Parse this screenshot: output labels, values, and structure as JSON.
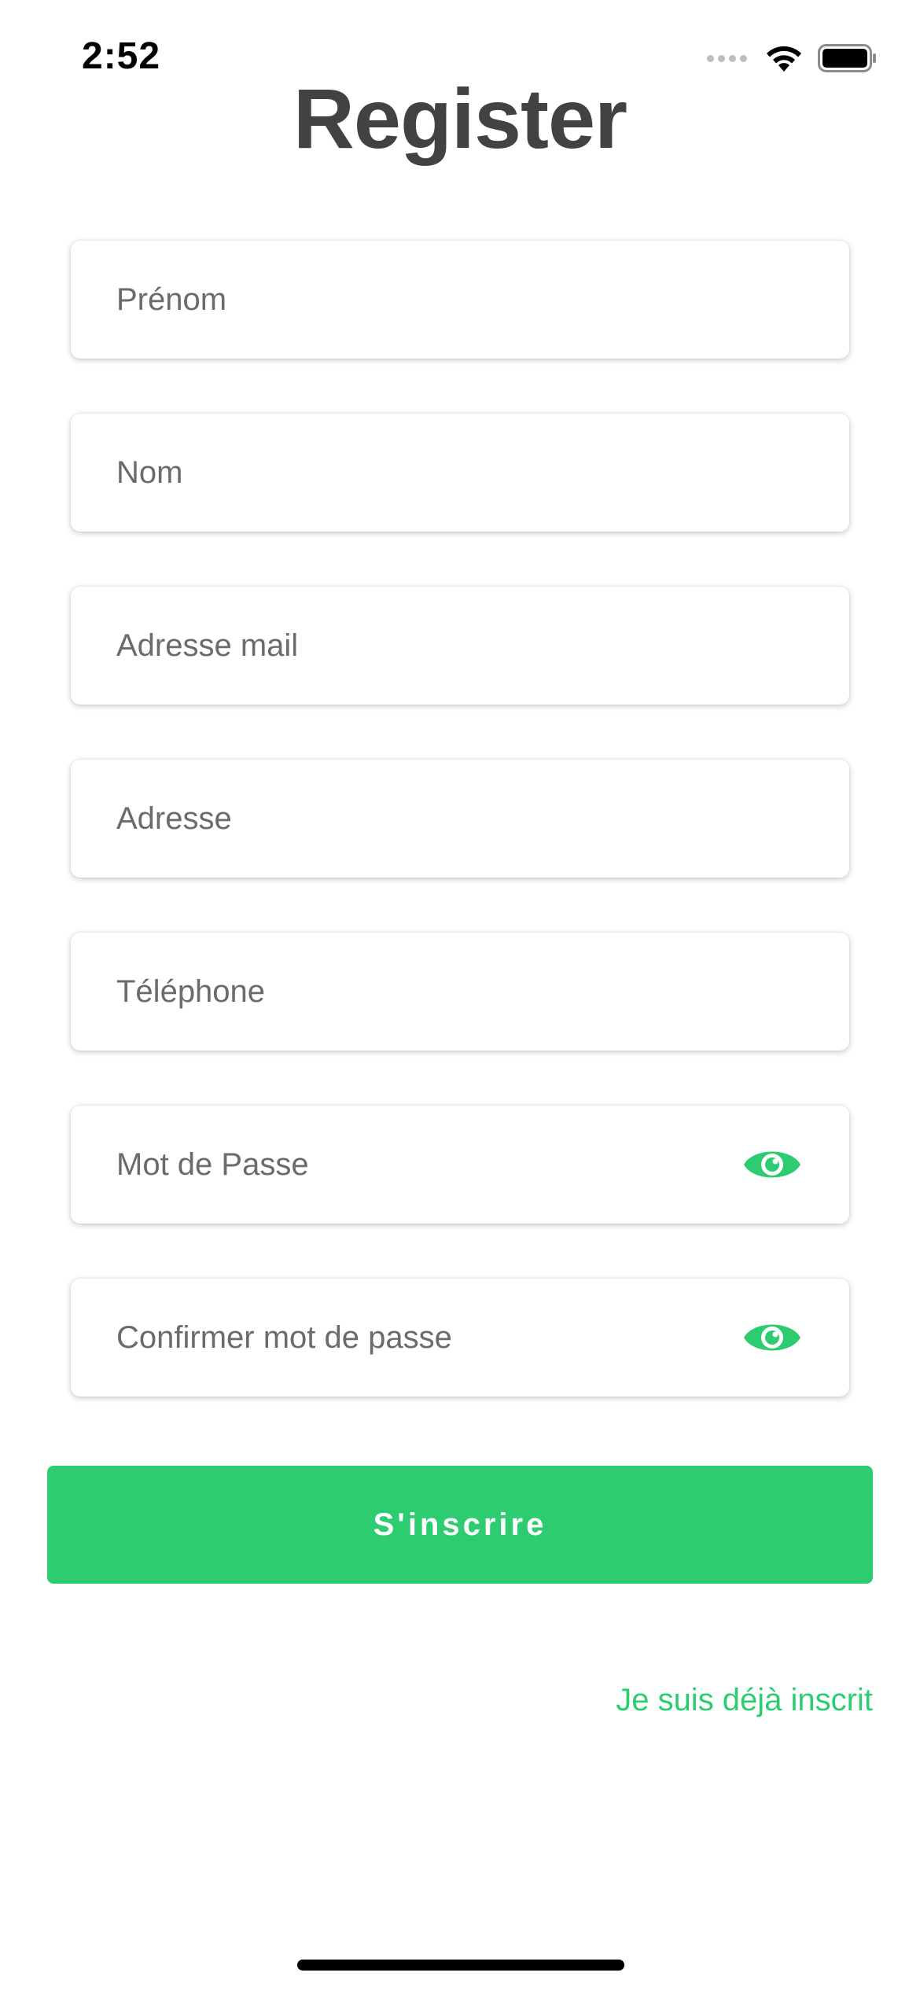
{
  "status_bar": {
    "time": "2:52"
  },
  "page": {
    "title": "Register"
  },
  "form": {
    "first_name": {
      "placeholder": "Prénom",
      "value": ""
    },
    "last_name": {
      "placeholder": "Nom",
      "value": ""
    },
    "email": {
      "placeholder": "Adresse mail",
      "value": ""
    },
    "address": {
      "placeholder": "Adresse",
      "value": ""
    },
    "phone": {
      "placeholder": "Téléphone",
      "value": ""
    },
    "password": {
      "placeholder": "Mot de Passe",
      "value": "",
      "toggle_icon": "eye-icon"
    },
    "confirm_password": {
      "placeholder": "Confirmer mot de passe",
      "value": "",
      "toggle_icon": "eye-icon"
    },
    "submit_label": "S'inscrire",
    "login_link_label": "Je suis déjà inscrit"
  },
  "colors": {
    "accent": "#2ecc71",
    "title": "#424242",
    "placeholder": "#6b6b6b"
  }
}
